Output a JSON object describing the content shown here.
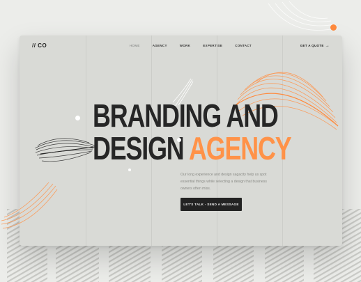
{
  "brand": {
    "logo": "// CO"
  },
  "nav": {
    "items": [
      {
        "label": "HOME",
        "active": true
      },
      {
        "label": "AGENCY",
        "active": false
      },
      {
        "label": "WORK",
        "active": false
      },
      {
        "label": "EXPERTISE",
        "active": false
      },
      {
        "label": "CONTACT",
        "active": false
      }
    ],
    "quote_label": "GET A QUOTE",
    "quote_icon": "arrow-right-icon"
  },
  "hero": {
    "line1": "BRANDING AND",
    "line2_plain": "DESIGN",
    "line2_accent": "AGENCY",
    "description": "Our long experience and design sagacity help us spot essential things while selecting a design that business owners often miss.",
    "cta_label": "LET'S TALK - SEND A MESSAGE"
  },
  "colors": {
    "accent": "#ff9248",
    "card_bg": "#d9dad6",
    "page_bg": "#ecedea",
    "dark": "#232323"
  }
}
